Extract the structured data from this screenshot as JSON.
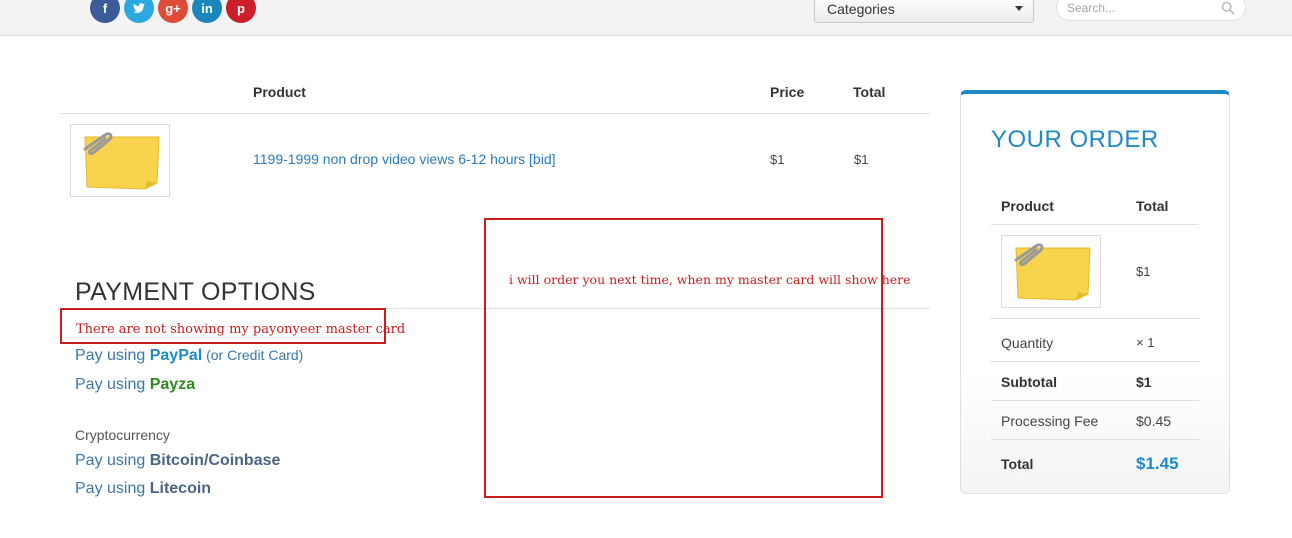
{
  "header": {
    "social": [
      {
        "name": "facebook",
        "glyph": "f"
      },
      {
        "name": "twitter",
        "glyph": "t"
      },
      {
        "name": "google-plus",
        "glyph": "g+"
      },
      {
        "name": "linkedin",
        "glyph": "in"
      },
      {
        "name": "pinterest",
        "glyph": "p"
      }
    ],
    "categories_label": "Categories",
    "search_placeholder": "Search..."
  },
  "cart": {
    "headers": {
      "product": "Product",
      "price": "Price",
      "total": "Total"
    },
    "item": {
      "name": "1199-1999 non drop video views 6-12 hours [bid]",
      "price": "$1",
      "total": "$1"
    }
  },
  "payment": {
    "title": "PAYMENT OPTIONS",
    "options": [
      {
        "prefix": "Pay using ",
        "brand": "PayPal",
        "suffix": " (or Credit Card)"
      },
      {
        "prefix": "Pay using ",
        "brand": "Payza",
        "suffix": ""
      }
    ],
    "crypto_label": "Cryptocurrency",
    "crypto_options": [
      {
        "prefix": "Pay using ",
        "brand": "Bitcoin/Coinbase"
      },
      {
        "prefix": "Pay using ",
        "brand": "Litecoin"
      }
    ]
  },
  "annotations": {
    "note1": "There are not showing my payonyeer master card",
    "note2": "i will order you next time, when my master card will show here"
  },
  "order": {
    "title": "YOUR ORDER",
    "headers": {
      "product": "Product",
      "total": "Total"
    },
    "item_total": "$1",
    "quantity_label": "Quantity",
    "quantity_value": "× 1",
    "subtotal_label": "Subtotal",
    "subtotal_value": "$1",
    "fee_label": "Processing Fee",
    "fee_value": "$0.45",
    "total_label": "Total",
    "total_value": "$1.45"
  },
  "colors": {
    "accent": "#1f8ac6",
    "annotation": "#c81e1e",
    "payza": "#2f8a1f"
  }
}
